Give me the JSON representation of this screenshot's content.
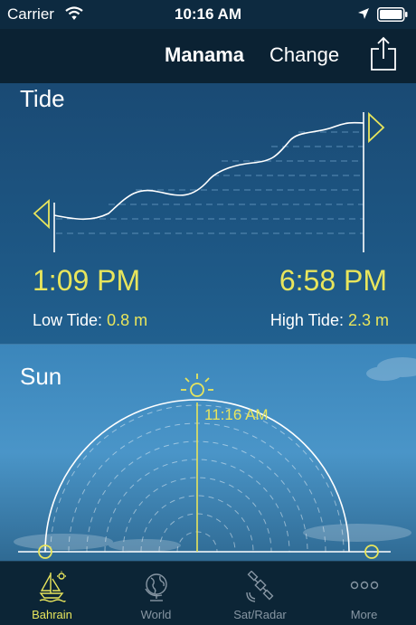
{
  "status_bar": {
    "carrier": "Carrier",
    "time": "10:16 AM"
  },
  "header": {
    "city": "Manama",
    "change_label": "Change"
  },
  "tide": {
    "title": "Tide",
    "low": {
      "time": "1:09 PM",
      "label": "Low Tide:",
      "value": "0.8 m"
    },
    "high": {
      "time": "6:58 PM",
      "label": "High Tide:",
      "value": "2.3 m"
    }
  },
  "sun": {
    "title": "Sun",
    "noon_time": "11:16 AM"
  },
  "tabs": [
    {
      "label": "Bahrain",
      "icon": "sailboat-icon",
      "active": true
    },
    {
      "label": "World",
      "icon": "globe-icon",
      "active": false
    },
    {
      "label": "Sat/Radar",
      "icon": "satellite-icon",
      "active": false
    },
    {
      "label": "More",
      "icon": "more-icon",
      "active": false
    }
  ],
  "colors": {
    "accent": "#e8e55c",
    "nav_bg": "#0b2233",
    "tab_inactive": "#8796a3"
  }
}
